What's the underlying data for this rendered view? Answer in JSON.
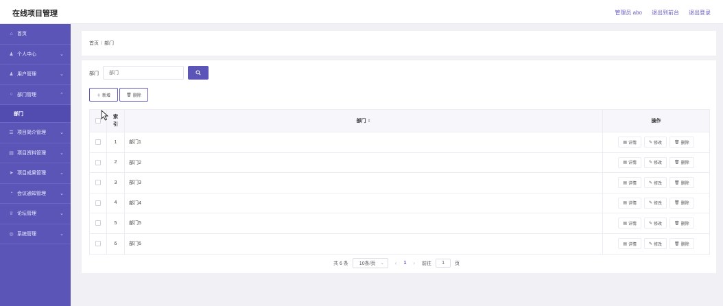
{
  "header": {
    "title": "在线项目管理",
    "admin": "管理员 abo",
    "to_front": "退出到前台",
    "logout": "退出登录"
  },
  "sidebar": {
    "items": [
      {
        "label": "首页",
        "icon": "home-icon"
      },
      {
        "label": "个人中心",
        "icon": "user-icon"
      },
      {
        "label": "用户管理",
        "icon": "user-icon"
      },
      {
        "label": "部门管理",
        "icon": "circle-icon"
      },
      {
        "label": "部门",
        "icon": ""
      },
      {
        "label": "项目简介管理",
        "icon": "list-icon"
      },
      {
        "label": "项目资料管理",
        "icon": "folder-icon"
      },
      {
        "label": "项目成果管理",
        "icon": "send-icon"
      },
      {
        "label": "会议通知管理",
        "icon": "bell-icon"
      },
      {
        "label": "论坛管理",
        "icon": "trophy-icon"
      },
      {
        "label": "系统管理",
        "icon": "settings-icon"
      }
    ]
  },
  "breadcrumb": {
    "home": "首页",
    "sep": "/",
    "current": "部门"
  },
  "search": {
    "label": "部门",
    "placeholder": "部门"
  },
  "actions": {
    "add": "新增",
    "delete": "删除"
  },
  "table": {
    "headers": {
      "index": "索引",
      "name": "部门",
      "ops": "操作"
    },
    "rows": [
      {
        "index": "1",
        "name": "部门1"
      },
      {
        "index": "2",
        "name": "部门2"
      },
      {
        "index": "3",
        "name": "部门3"
      },
      {
        "index": "4",
        "name": "部门4"
      },
      {
        "index": "5",
        "name": "部门5"
      },
      {
        "index": "6",
        "name": "部门6"
      }
    ],
    "row_ops": {
      "detail": "详情",
      "edit": "修改",
      "delete": "删除"
    }
  },
  "pagination": {
    "total": "共 6 条",
    "page_size": "10条/页",
    "current_page": "1",
    "goto_label": "前往",
    "goto_value": "1",
    "page_unit": "页"
  },
  "colors": {
    "primary": "#5b55b8"
  }
}
